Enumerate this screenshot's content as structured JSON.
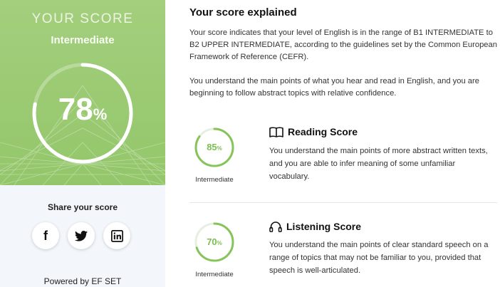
{
  "score_panel": {
    "heading": "YOUR SCORE",
    "level": "Intermediate",
    "score_value": "78",
    "score_percent_sign": "%",
    "score_fraction": 0.78,
    "accent_color": "#a4cf7d"
  },
  "share": {
    "title": "Share your score",
    "buttons": [
      {
        "icon": "facebook-icon",
        "glyph": "f"
      },
      {
        "icon": "twitter-icon",
        "glyph": "bird"
      },
      {
        "icon": "linkedin-icon",
        "glyph": "in"
      }
    ]
  },
  "footer": {
    "powered_by": "Powered by EF SET"
  },
  "explanation": {
    "title": "Your score explained",
    "paragraph1": "Your score indicates that your level of English is in the range of B1 INTERMEDIATE to B2 UPPER INTERMEDIATE, according to the guidelines set by the Common European Framework of Reference (CEFR).",
    "paragraph2": "You understand the main points of what you hear and read in English, and you are beginning to follow abstract topics with relative confidence."
  },
  "sections": {
    "reading": {
      "title": "Reading Score",
      "icon": "book-icon",
      "value": "85",
      "percent_sign": "%",
      "fraction": 0.85,
      "level": "Intermediate",
      "description": "You understand the main points of more abstract written texts, and you are able to infer meaning of some unfamiliar vocabulary."
    },
    "listening": {
      "title": "Listening Score",
      "icon": "headphones-icon",
      "value": "70",
      "percent_sign": "%",
      "fraction": 0.7,
      "level": "Intermediate",
      "description": "You understand the main points of clear standard speech on a range of topics that may not be familiar to you, provided that speech is well-articulated."
    }
  }
}
